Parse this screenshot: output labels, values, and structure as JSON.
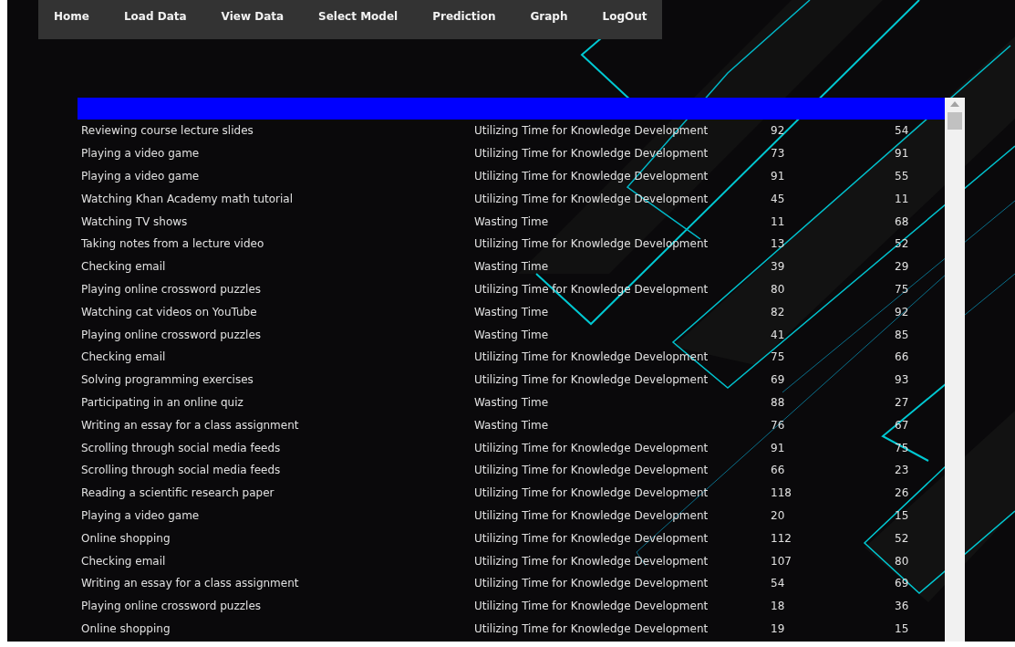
{
  "nav": [
    "Home",
    "Load Data",
    "View Data",
    "Select Model",
    "Prediction",
    "Graph",
    "LogOut"
  ],
  "table": {
    "rows": [
      [
        "Reviewing course lecture slides",
        "Utilizing Time for Knowledge Development",
        "92",
        "54"
      ],
      [
        "Playing a video game",
        "Utilizing Time for Knowledge Development",
        "73",
        "91"
      ],
      [
        "Playing a video game",
        "Utilizing Time for Knowledge Development",
        "91",
        "55"
      ],
      [
        "Watching Khan Academy math tutorial",
        "Utilizing Time for Knowledge Development",
        "45",
        "11"
      ],
      [
        "Watching TV shows",
        "Wasting Time",
        "11",
        "68"
      ],
      [
        "Taking notes from a lecture video",
        "Utilizing Time for Knowledge Development",
        "13",
        "52"
      ],
      [
        "Checking email",
        "Wasting Time",
        "39",
        "29"
      ],
      [
        "Playing online crossword puzzles",
        "Utilizing Time for Knowledge Development",
        "80",
        "75"
      ],
      [
        "Watching cat videos on YouTube",
        "Wasting Time",
        "82",
        "92"
      ],
      [
        "Playing online crossword puzzles",
        "Wasting Time",
        "41",
        "85"
      ],
      [
        "Checking email",
        "Utilizing Time for Knowledge Development",
        "75",
        "66"
      ],
      [
        "Solving programming exercises",
        "Utilizing Time for Knowledge Development",
        "69",
        "93"
      ],
      [
        "Participating in an online quiz",
        "Wasting Time",
        "88",
        "27"
      ],
      [
        "Writing an essay for a class assignment",
        "Wasting Time",
        "76",
        "67"
      ],
      [
        "Scrolling through social media feeds",
        "Utilizing Time for Knowledge Development",
        "91",
        "75"
      ],
      [
        "Scrolling through social media feeds",
        "Utilizing Time for Knowledge Development",
        "66",
        "23"
      ],
      [
        "Reading a scientific research paper",
        "Utilizing Time for Knowledge Development",
        "118",
        "26"
      ],
      [
        "Playing a video game",
        "Utilizing Time for Knowledge Development",
        "20",
        "15"
      ],
      [
        "Online shopping",
        "Utilizing Time for Knowledge Development",
        "112",
        "52"
      ],
      [
        "Checking email",
        "Utilizing Time for Knowledge Development",
        "107",
        "80"
      ],
      [
        "Writing an essay for a class assignment",
        "Utilizing Time for Knowledge Development",
        "54",
        "69"
      ],
      [
        "Playing online crossword puzzles",
        "Utilizing Time for Knowledge Development",
        "18",
        "36"
      ],
      [
        "Online shopping",
        "Utilizing Time for Knowledge Development",
        "19",
        "15"
      ]
    ]
  }
}
